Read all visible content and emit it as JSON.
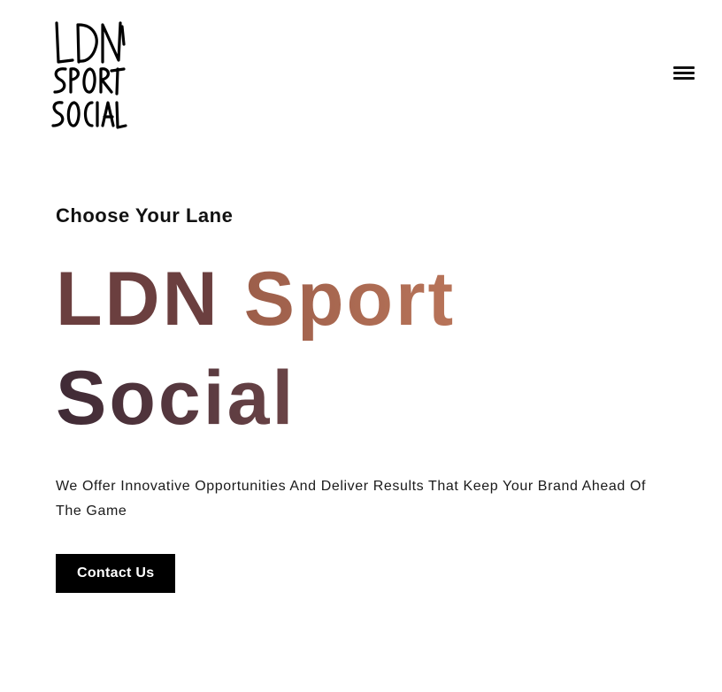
{
  "header": {
    "logo_lines": [
      "LDN",
      "SPORT",
      "SOCIAL"
    ],
    "menu_icon": "hamburger-menu-icon"
  },
  "hero": {
    "eyebrow": "Choose Your Lane",
    "headline": {
      "word1": "LDN",
      "word2": "Sport",
      "word3": "Social"
    },
    "description": "We Offer Innovative Opportunities And Deliver Results That Keep Your Brand Ahead Of The Game",
    "cta_label": "Contact Us"
  },
  "colors": {
    "background": "#ffffff",
    "cta_background": "#000000",
    "headline_ldn": "#6b3f3f",
    "headline_sport": "#b87459",
    "headline_social": "#3f2a35"
  }
}
